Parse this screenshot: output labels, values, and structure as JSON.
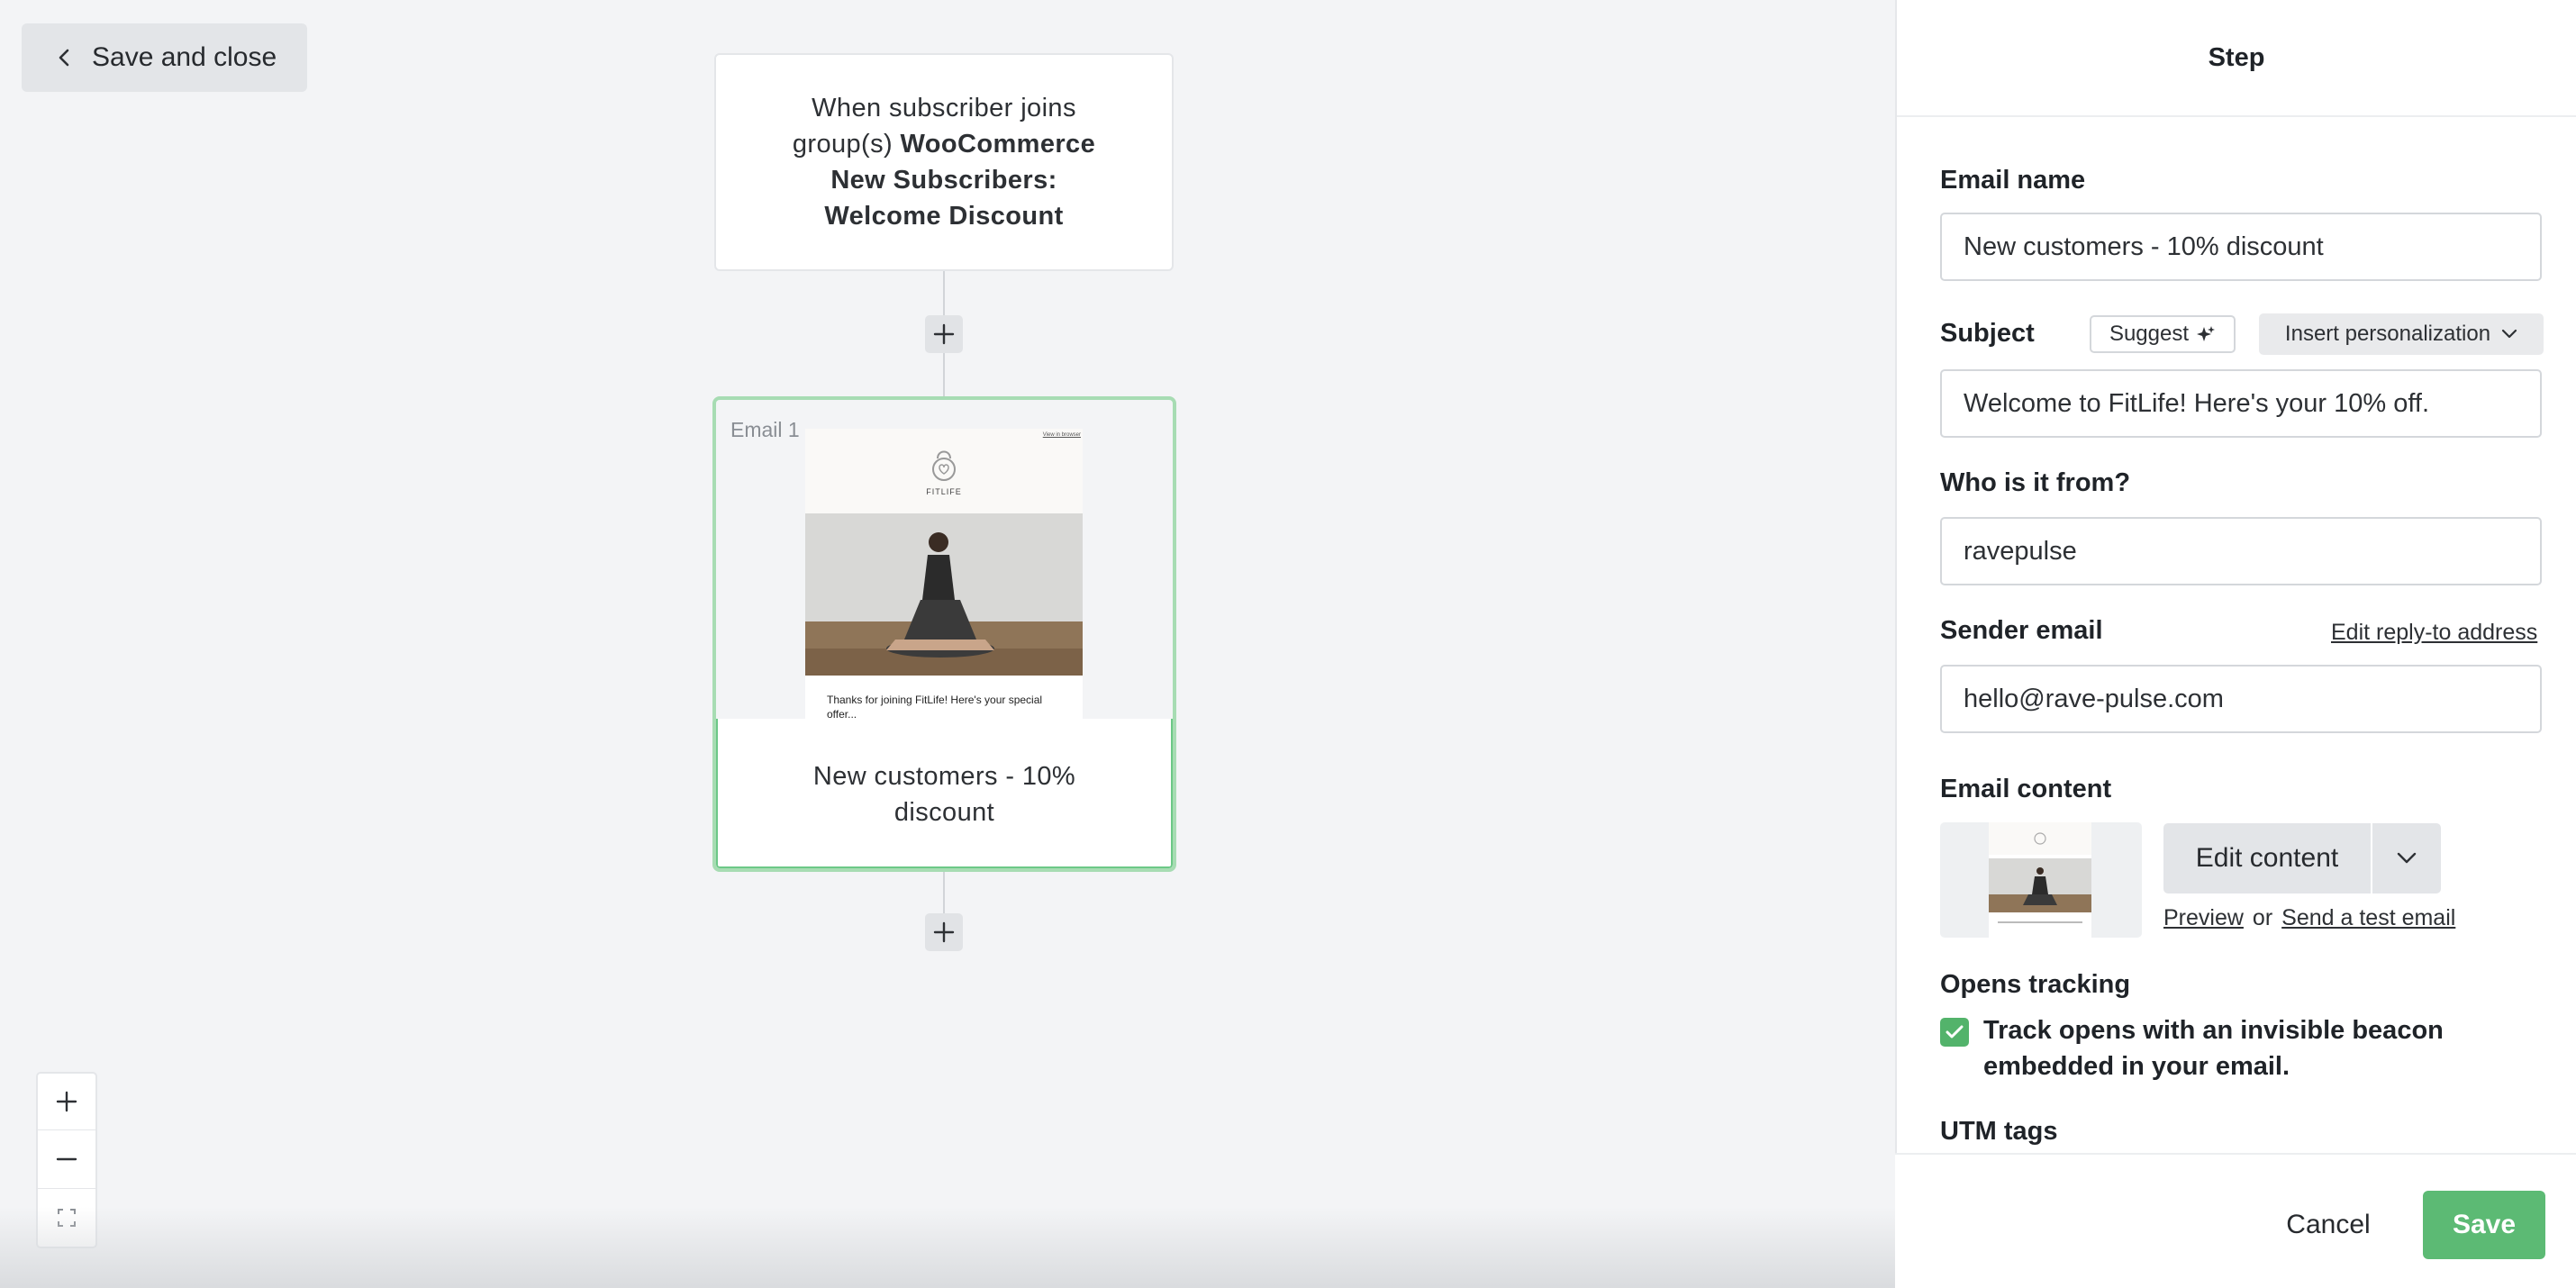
{
  "toolbar": {
    "save_close_label": "Save and close"
  },
  "trigger": {
    "prefix": "When subscriber joins group(s) ",
    "group_name": "WooCommerce New Subscribers: Welcome Discount"
  },
  "email_step": {
    "tag": "Email 1",
    "name": "New customers - 10% discount",
    "preview": {
      "browser_link": "View in browser",
      "logo_text": "FITLIFE",
      "body_text": "Thanks for joining FitLife! Here's your special offer..."
    }
  },
  "panel": {
    "title": "Step",
    "email_name": {
      "label": "Email name",
      "value": "New customers - 10% discount"
    },
    "subject": {
      "label": "Subject",
      "suggest_label": "Suggest",
      "insert_label": "Insert personalization",
      "value": "Welcome to FitLife! Here's your 10% off."
    },
    "from": {
      "label": "Who is it from?",
      "value": "ravepulse"
    },
    "sender_email": {
      "label": "Sender email",
      "edit_link": "Edit reply-to address",
      "value": "hello@rave-pulse.com"
    },
    "email_content": {
      "label": "Email content",
      "edit_label": "Edit content",
      "preview_link": "Preview",
      "or_text": "or",
      "test_link": "Send a test email"
    },
    "opens_tracking": {
      "label": "Opens tracking",
      "checkbox_label": "Track opens with an invisible beacon embedded in your email.",
      "checked": true
    },
    "utm": {
      "label": "UTM tags"
    }
  },
  "footer": {
    "cancel_label": "Cancel",
    "save_label": "Save"
  },
  "colors": {
    "accent_green": "#5cba74",
    "selected_border": "#6cc887"
  }
}
